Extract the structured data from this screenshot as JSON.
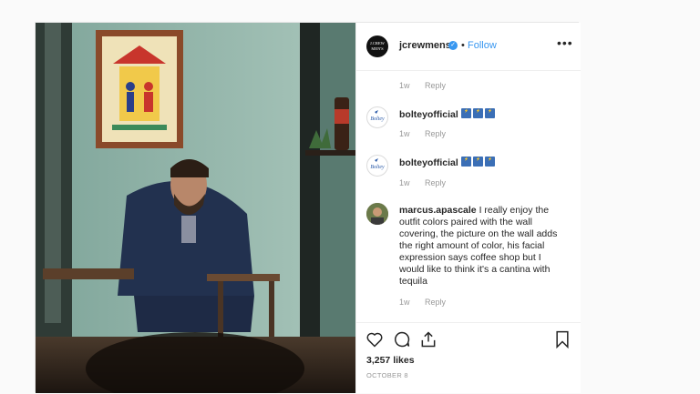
{
  "post": {
    "author": "jcrewmens",
    "follow_label": "Follow",
    "dot": "•",
    "more": "•••",
    "logo_line1": "J.CREW",
    "logo_line2": "MEN'S"
  },
  "comments": [
    {
      "user": "",
      "time": "1w",
      "reply": "Reply"
    },
    {
      "user": "bolteyofficial",
      "time": "1w",
      "reply": "Reply",
      "emojis": [
        "⚡",
        "⚡",
        "⚡"
      ]
    },
    {
      "user": "bolteyofficial",
      "time": "1w",
      "reply": "Reply",
      "emojis": [
        "⚡",
        "⚡",
        "⚡"
      ]
    },
    {
      "user": "marcus.apascale",
      "text": "I really enjoy the outfit colors paired with the wall covering, the picture on the wall adds the right amount of color, his facial expression says coffee shop but I would like to think it's a cantina with tequila",
      "time": "1w",
      "reply": "Reply"
    }
  ],
  "likes": "3,257 likes",
  "date": "OCTOBER 8",
  "colors": {
    "accent": "#3897f0",
    "text": "#262626",
    "muted": "#999999"
  },
  "icons": [
    "heart-icon",
    "comment-icon",
    "share-icon",
    "bookmark-icon",
    "verified-badge-icon"
  ]
}
